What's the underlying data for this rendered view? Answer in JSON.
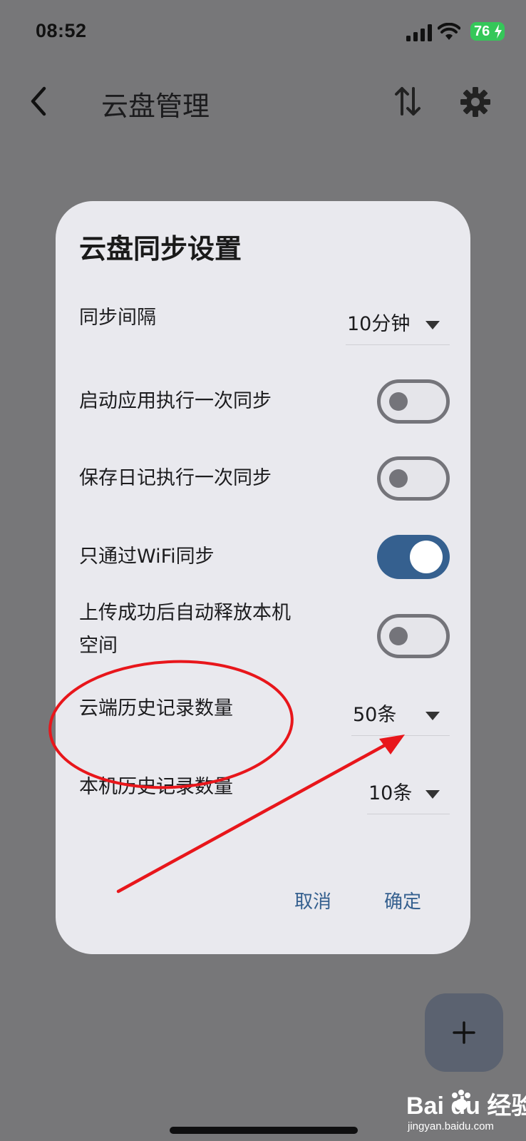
{
  "status_bar": {
    "time": "08:52",
    "battery": "76"
  },
  "app_bar": {
    "title": "云盘管理",
    "icons": [
      "back-icon",
      "sort-icon",
      "gear-icon"
    ]
  },
  "dialog": {
    "title": "云盘同步设置",
    "rows": [
      {
        "label": "同步间隔",
        "type": "dropdown",
        "value": "10分钟"
      },
      {
        "label": "启动应用执行一次同步",
        "type": "toggle",
        "checked": false
      },
      {
        "label": "保存日记执行一次同步",
        "type": "toggle",
        "checked": false
      },
      {
        "label": "只通过WiFi同步",
        "type": "toggle",
        "checked": true
      },
      {
        "label_line1": "上传成功后自动释放本机",
        "label_line2": "空间",
        "type": "toggle",
        "checked": false
      },
      {
        "label": "云端历史记录数量",
        "type": "dropdown",
        "value": "50条"
      },
      {
        "label": "本机历史记录数量",
        "type": "dropdown",
        "value": "10条"
      }
    ],
    "cancel_label": "取消",
    "confirm_label": "确定"
  },
  "fab": {
    "icon": "plus-icon"
  },
  "colors": {
    "accent": "#35608f",
    "overlay": "#777779",
    "dialog_bg": "#e9e9ee",
    "annotation": "#e8161b",
    "battery": "#35c759"
  },
  "watermark": {
    "brand": "Bai du 经验",
    "url": "jingyan.baidu.com"
  }
}
